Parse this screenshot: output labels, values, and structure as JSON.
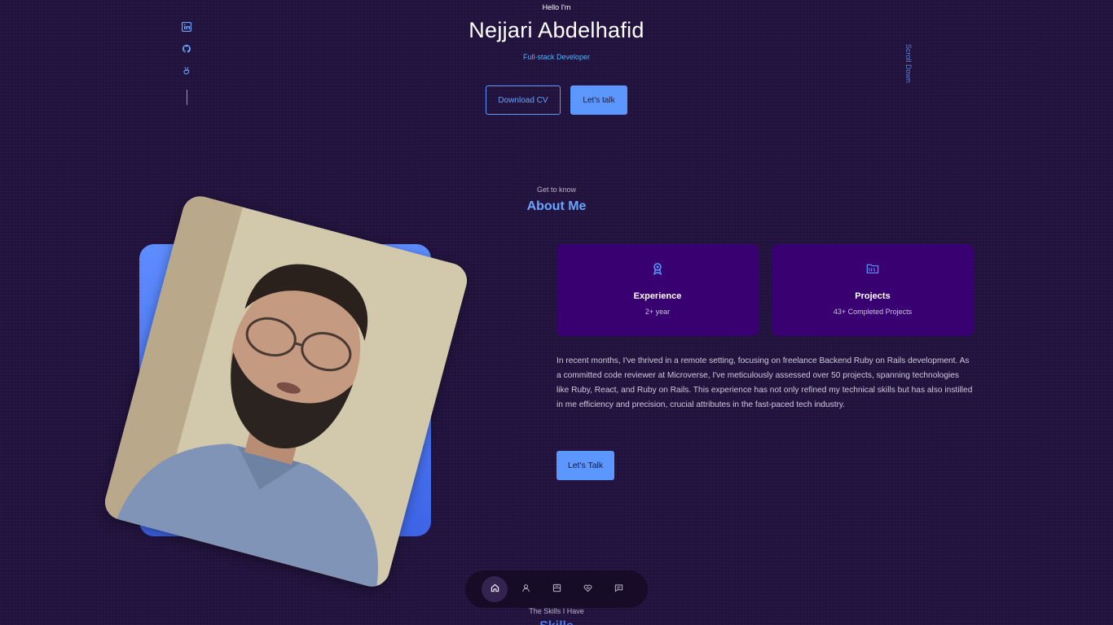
{
  "header": {
    "greeting": "Hello I'm",
    "name": "Nejjari Abdelhafid",
    "role": "Full-stack Developer",
    "download_cv": "Download CV",
    "lets_talk": "Let's talk"
  },
  "socials": [
    {
      "icon": "linkedin-icon"
    },
    {
      "icon": "github-icon"
    },
    {
      "icon": "angellist-icon"
    }
  ],
  "scroll_down": "Scroll Down",
  "about": {
    "subtitle": "Get to know",
    "title": "About Me",
    "cards": [
      {
        "icon": "award-icon",
        "title": "Experience",
        "subtitle": "2+ year"
      },
      {
        "icon": "folder-icon",
        "title": "Projects",
        "subtitle": "43+ Completed Projects"
      }
    ],
    "description": "In recent months, I've thrived in a remote setting, focusing on freelance Backend Ruby on Rails development. As a committed code reviewer at Microverse, I've meticulously assessed over 50 projects, spanning technologies like Ruby, React, and Ruby on Rails. This experience has not only refined my technical skills but has also instilled in me efficiency and precision, crucial attributes in the fast-paced tech industry.",
    "cta": "Let's Talk"
  },
  "nav": {
    "items": [
      {
        "icon": "home-icon",
        "active": true
      },
      {
        "icon": "user-icon",
        "active": false
      },
      {
        "icon": "book-icon",
        "active": false
      },
      {
        "icon": "services-icon",
        "active": false
      },
      {
        "icon": "message-icon",
        "active": false
      }
    ]
  },
  "skills": {
    "subtitle": "The Skills I Have",
    "title": "Skills"
  },
  "colors": {
    "background": "#20123d",
    "accent": "#5b97ff",
    "card": "#380070"
  }
}
